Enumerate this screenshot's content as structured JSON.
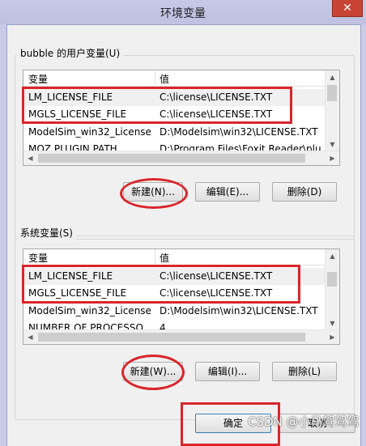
{
  "window": {
    "title": "环境变量",
    "close_symbol": "✕"
  },
  "user_vars": {
    "group_label": "bubble 的用户变量(U)",
    "col_var": "变量",
    "col_val": "值",
    "rows": [
      {
        "name": "LM_LICENSE_FILE",
        "value": "C:\\license\\LICENSE.TXT"
      },
      {
        "name": "MGLS_LICENSE_FILE",
        "value": "C:\\license\\LICENSE.TXT"
      },
      {
        "name": "ModelSim_win32_License",
        "value": "D:\\Modelsim\\win32\\LICENSE.TXT"
      },
      {
        "name": "MOZ PLUGIN PATH",
        "value": "D:\\Program Files\\Foxit Reader\\plu"
      }
    ],
    "btn_new": "新建(N)...",
    "btn_edit": "编辑(E)...",
    "btn_delete": "删除(D)"
  },
  "sys_vars": {
    "group_label": "系统变量(S)",
    "col_var": "变量",
    "col_val": "值",
    "rows": [
      {
        "name": "LM_LICENSE_FILE",
        "value": "C:\\license\\LICENSE.TXT"
      },
      {
        "name": "MGLS_LICENSE_FILE",
        "value": "C:\\license\\LICENSE.TXT"
      },
      {
        "name": "ModelSim_win32_License",
        "value": "D:\\Modelsim\\win32\\LICENSE.TXT"
      },
      {
        "name": "NUMBER OF PROCESSO...",
        "value": "4"
      }
    ],
    "btn_new": "新建(W)...",
    "btn_edit": "编辑(I)...",
    "btn_delete": "删除(L)"
  },
  "footer": {
    "btn_ok": "确定",
    "btn_cancel": "取消"
  },
  "watermark": "CSDN @小马驾驾驾",
  "colors": {
    "annotation_red": "#d9252b",
    "title_bg": "#c6c8e6",
    "close_bg": "#c84434"
  }
}
